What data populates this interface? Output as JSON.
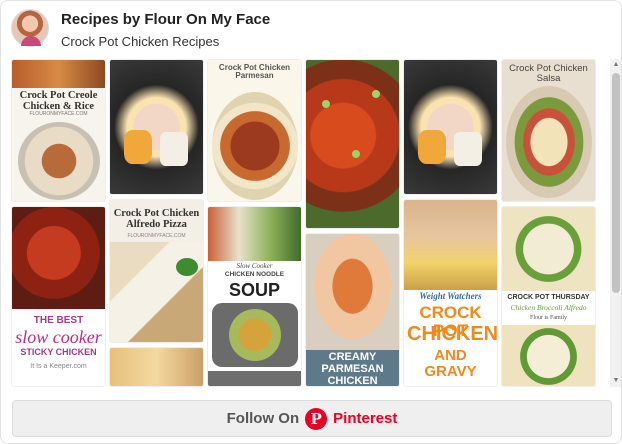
{
  "header": {
    "title": "Recipes by Flour On My Face",
    "subtitle": "Crock Pot Chicken Recipes"
  },
  "pins": [
    {
      "label": "Crock Pot Creole Chicken & Rice",
      "site": "FLOURONMYFACE.COM"
    },
    {
      "label": ""
    },
    {
      "label": "Crock Pot Chicken Parmesan"
    },
    {
      "label": ""
    },
    {
      "label": ""
    },
    {
      "label": "Crock Pot Chicken Salsa"
    },
    {
      "label": "The Best Slow Cooker Sticky Chicken",
      "line1": "THE BEST",
      "line2": "slow cooker",
      "line3": "STICKY CHICKEN",
      "site": "It Is a Keeper.com"
    },
    {
      "label": "Crock Pot Chicken Alfredo Pizza",
      "site": "FLOURONMYFACE.COM"
    },
    {
      "label": "Slow Cooker Chicken Noodle Soup",
      "line1": "Slow Cooker",
      "line2": "CHICKEN NOODLE",
      "line3": "SOUP"
    },
    {
      "label": "Creamy Parmesan Chicken",
      "line1": "CREAMY",
      "line2": "PARMESAN",
      "line3": "CHICKEN"
    },
    {
      "label": "Weight Watchers Crock Pot Chicken and Gravy",
      "line1": "Weight Watchers",
      "line2": "CROCK POT",
      "line3": "CHICKEN",
      "line4": "AND GRAVY"
    },
    {
      "label": "Crock Pot Thursday Chicken Broccoli Alfredo",
      "line1": "CROCK POT THURSDAY",
      "line2": "Chicken Broccoli Alfredo",
      "line3": "Flour is Family"
    }
  ],
  "scrollbar": {
    "up": "▲",
    "down": "▼"
  },
  "follow": {
    "text": "Follow On",
    "icon": "P",
    "brand": "Pinterest"
  },
  "colors": {
    "pinterest_red": "#e60023"
  }
}
